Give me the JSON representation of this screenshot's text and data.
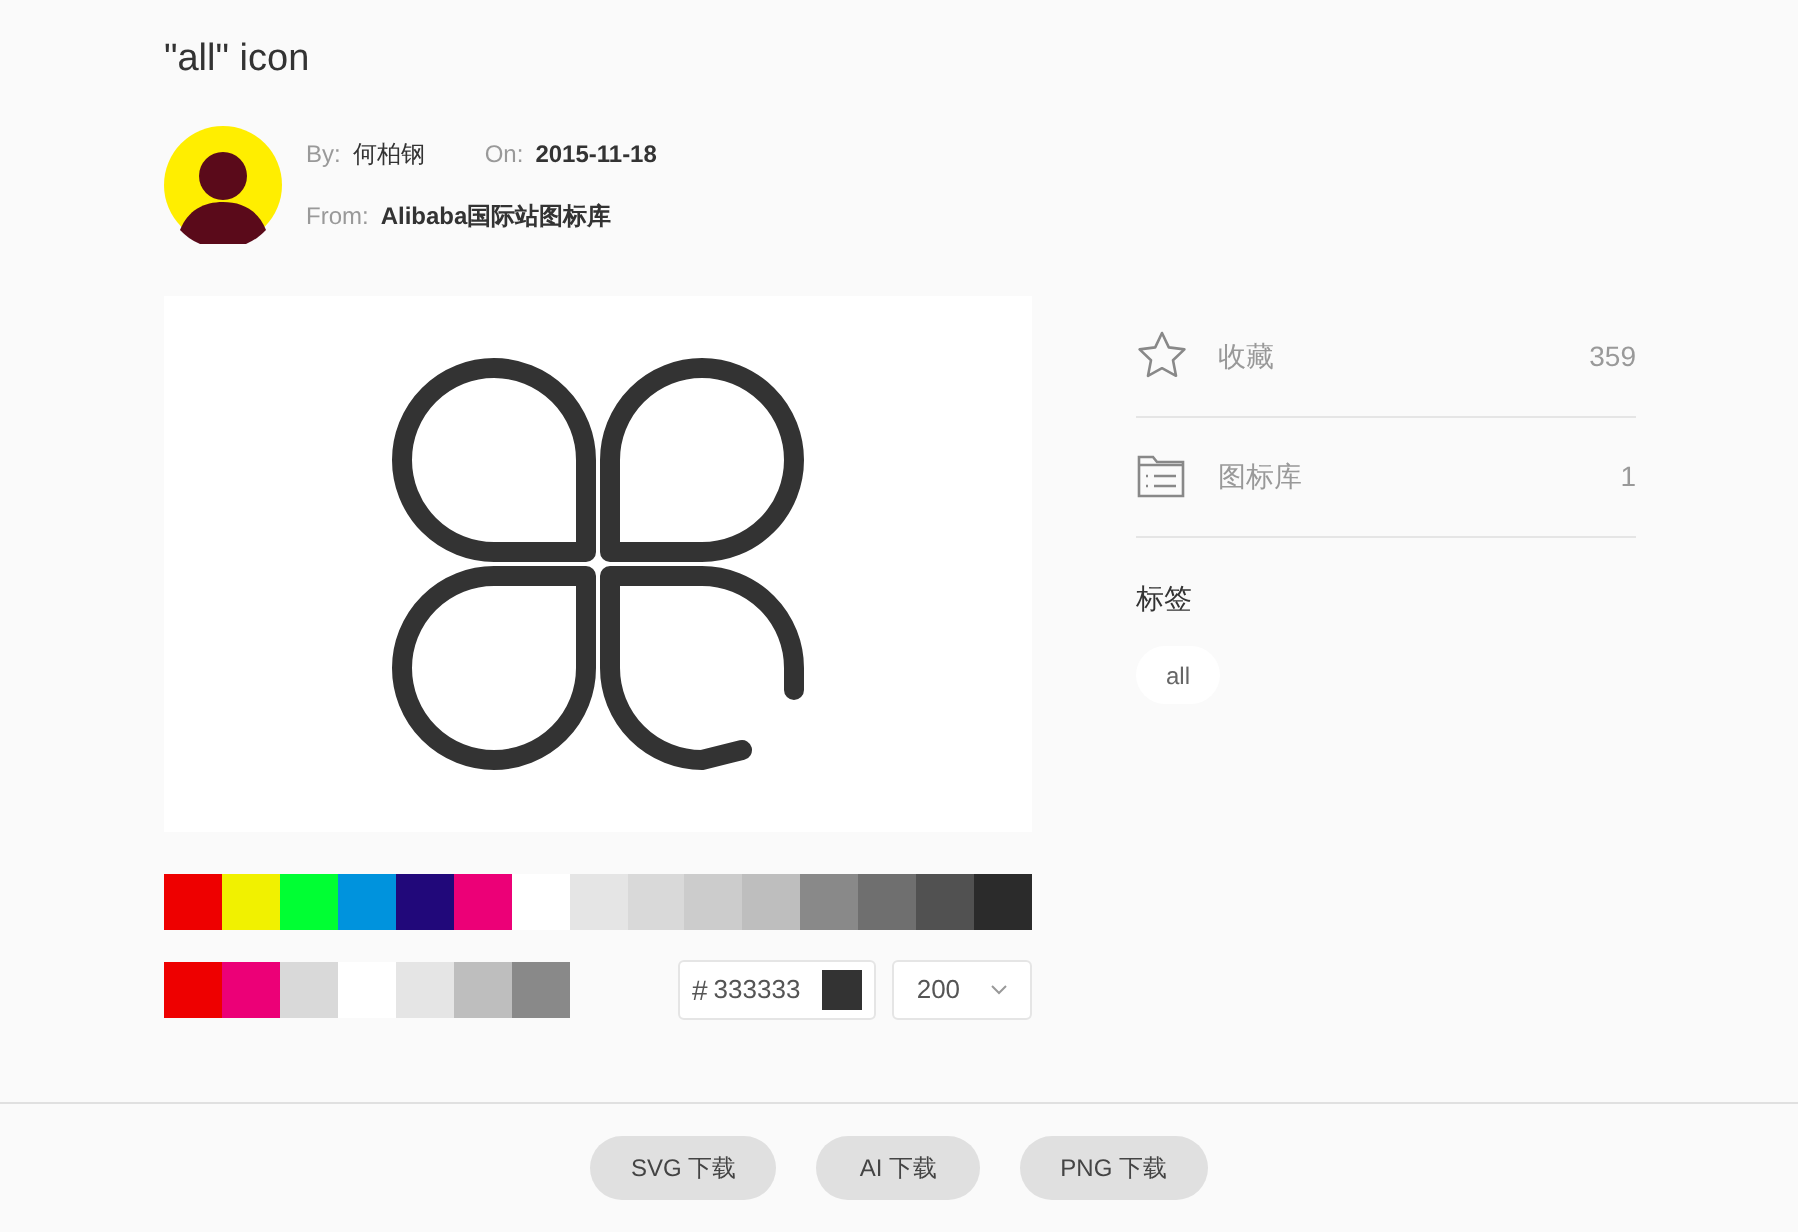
{
  "title": "\"all\" icon",
  "meta": {
    "by_label": "By:",
    "by": "何柏钢",
    "on_label": "On:",
    "on": "2015-11-18",
    "from_label": "From:",
    "from": "Alibaba国际站图标库"
  },
  "stats": [
    {
      "kind": "star",
      "label": "收藏",
      "count": "359"
    },
    {
      "kind": "library",
      "label": "图标库",
      "count": "1"
    }
  ],
  "tags_title": "标签",
  "tags": [
    "all"
  ],
  "palette": [
    {
      "color": "#ee0000"
    },
    {
      "color": "#f1f100"
    },
    {
      "color": "#00ff33"
    },
    {
      "color": "#0093dd"
    },
    {
      "color": "#21087a"
    },
    {
      "color": "#ec0077"
    },
    {
      "color": "#ffffff"
    },
    {
      "color": "#e5e5e5"
    },
    {
      "color": "#d9d9d9"
    },
    {
      "color": "#cccccc"
    },
    {
      "color": "#bebebe"
    },
    {
      "color": "#898989"
    },
    {
      "color": "#6f6f6f"
    },
    {
      "color": "#515151"
    },
    {
      "color": "#2b2b2b"
    }
  ],
  "recent": [
    {
      "color": "#ee0000"
    },
    {
      "color": "#ec0077"
    },
    {
      "color": "#d9d9d9"
    },
    {
      "color": "#ffffff"
    },
    {
      "color": "#e5e5e5"
    },
    {
      "color": "#bebebe"
    },
    {
      "color": "#898989"
    }
  ],
  "color_field": {
    "hash": "#",
    "value": "333333",
    "color": "#333333"
  },
  "size_select": {
    "value": "200"
  },
  "downloads": [
    "SVG 下载",
    "AI 下载",
    "PNG 下载"
  ]
}
